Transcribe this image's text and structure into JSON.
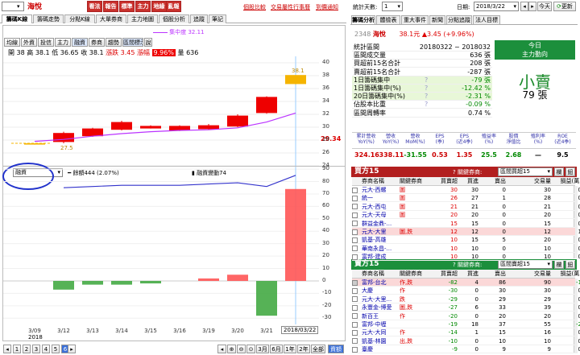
{
  "stock": {
    "code": "2348",
    "name": "海悅",
    "price": "38.1元",
    "change": "▲3.45 (+9.96%)"
  },
  "top": {
    "dropdown": "",
    "buttons": [
      "看法",
      "報告",
      "標準",
      "主力",
      "地緣",
      "亂報"
    ],
    "links": [
      "個股比較",
      "交易屬性",
      "行事曆",
      "到價通知"
    ]
  },
  "left_tabs": [
    "籌碼K線",
    "籌碼走勢",
    "分點K線",
    "大單券商",
    "主力地圖",
    "個股分析",
    "追蹤",
    "筆記"
  ],
  "toolbar": {
    "buttons": [
      "均線",
      "外資",
      "投信",
      "主力",
      "融資",
      "券商",
      "趨勢",
      "區間標示",
      "說"
    ],
    "ma_label": "集中度 32.11"
  },
  "ohlc": {
    "open_l": "開",
    "open": "38",
    "high_l": "高",
    "high": "38.1",
    "low_l": "低",
    "low": "36.65",
    "close_l": "收",
    "close": "38.1",
    "chg_l": "漲跌",
    "chg": "3.45",
    "pct_l": "漲幅",
    "pct": "9.96%",
    "vol_l": "量",
    "vol": "636"
  },
  "price_axis": [
    "40",
    "38",
    "36",
    "34",
    "32",
    "30",
    "28",
    "26",
    "24"
  ],
  "price_tag": "29.34",
  "bar_labels": {
    "top": "38.1",
    "bottom": "27.5"
  },
  "sub": {
    "select": "融資",
    "left_legend": "━ 餘額444 (2.07%)",
    "right_legend": "▮ 融資變動74"
  },
  "sub_axis": [
    "90",
    "80",
    "70",
    "60",
    "50",
    "40",
    "30",
    "20",
    "10",
    "0",
    "-10",
    "-20",
    "-30"
  ],
  "dates": [
    "3/09",
    "3/12",
    "3/13",
    "3/14",
    "3/15",
    "3/16",
    "3/19",
    "3/20",
    "3/21"
  ],
  "year": "2018",
  "date_tag": "2018/03/22",
  "pager": {
    "pages": [
      "1",
      "2",
      "3",
      "4",
      "5",
      "6"
    ],
    "ranges": [
      "3月",
      "6月",
      "1年",
      "2年",
      "全部"
    ],
    "active": "6",
    "zoom_active": "資額"
  },
  "right_top": {
    "days_label": "統計天數:",
    "days": "1",
    "date_label": "日期:",
    "date": "2018/3/22",
    "today": "今天",
    "refresh": "更新"
  },
  "right_tabs": [
    "籌碼分析",
    "體檢表",
    "重大事件",
    "新聞",
    "分點追蹤",
    "法人目標"
  ],
  "stats": [
    {
      "label": "統計區間",
      "value": "20180322 ~ 2018032"
    },
    {
      "label": "區間成交量",
      "value": "636 張"
    },
    {
      "label": "買超前15名合計",
      "value": "208 張"
    },
    {
      "label": "賣超前15名合計",
      "value": "-287 張"
    },
    {
      "label": "1日籌碼集中",
      "value": "-79 張"
    },
    {
      "label": "1日籌碼集中(%)",
      "value": "-12.42 %"
    },
    {
      "label": "20日籌碼集中(%)",
      "value": "-2.31 %"
    },
    {
      "label": "佔股本比重",
      "value": "-0.09 %"
    },
    {
      "label": "區間周轉率",
      "value": "0.74 %"
    }
  ],
  "today_box": {
    "title": "今日",
    "sub": "主力動向",
    "action": "小賣",
    "amount": "79 張"
  },
  "kpi": {
    "headers": [
      "累計營收\nYoY(%)",
      "營收\nYoY(%)",
      "營收\nMoM(%)",
      "EPS\n(季)",
      "EPS\n(近4季)",
      "殖益率\n(%)",
      "股價\n淨值比",
      "殖利率\n(%)",
      "ROE\n(近4季)"
    ],
    "values": [
      "324.16",
      "338.11",
      "-31.55",
      "0.53",
      "1.35",
      "25.5",
      "2.68",
      "—",
      "9.5"
    ]
  },
  "buy": {
    "title": "買方15",
    "ctrl": "關鍵券商:",
    "select": "區間買超15",
    "b1": "欄",
    "b2": "鈕",
    "headers": [
      "",
      "券商名稱",
      "關鍵券商",
      "買賣超",
      "買進",
      "賣出",
      "交易量",
      "損益(萬)"
    ],
    "rows": [
      [
        "元大-西螺",
        "圖",
        "30",
        "30",
        "0",
        "30",
        "0"
      ],
      [
        "統一",
        "圖",
        "26",
        "27",
        "1",
        "28",
        "0"
      ],
      [
        "元大-西屯",
        "圖",
        "21",
        "21",
        "0",
        "21",
        "0"
      ],
      [
        "元大-天母",
        "圖",
        "20",
        "20",
        "0",
        "20",
        "0"
      ],
      [
        "群益金鼎-...",
        "",
        "15",
        "15",
        "0",
        "15",
        "0"
      ],
      [
        "元大-大里",
        "圖,跌",
        "12",
        "12",
        "0",
        "12",
        "1"
      ],
      [
        "凱基-高雄",
        "",
        "10",
        "15",
        "5",
        "20",
        "0"
      ],
      [
        "華南永昌-...",
        "",
        "10",
        "10",
        "0",
        "10",
        "0"
      ],
      [
        "富邦-建成",
        "",
        "10",
        "10",
        "0",
        "10",
        "0"
      ]
    ]
  },
  "sell": {
    "title": "賣方15",
    "ctrl": "關鍵券商:",
    "select": "區間賣超15",
    "b1": "欄",
    "b2": "鈕",
    "headers": [
      "",
      "券商名稱",
      "關鍵券商",
      "買賣超",
      "買進",
      "賣出",
      "交易量",
      "損益(萬)"
    ],
    "rows": [
      [
        "富邦-台北",
        "作,跌",
        "-82",
        "4",
        "86",
        "90",
        "-1"
      ],
      [
        "大慶",
        "作",
        "-30",
        "0",
        "30",
        "30",
        "0"
      ],
      [
        "元大-大里...",
        "跌",
        "-29",
        "0",
        "29",
        "29",
        "0"
      ],
      [
        "永豐金-博愛",
        "圖,跌",
        "-27",
        "6",
        "33",
        "39",
        "0"
      ],
      [
        "新百王",
        "作",
        "-20",
        "0",
        "20",
        "20",
        "0"
      ],
      [
        "富邦-中壢",
        "",
        "-19",
        "18",
        "37",
        "55",
        "-2"
      ],
      [
        "元大-大同",
        "作",
        "-14",
        "1",
        "15",
        "16",
        "0"
      ],
      [
        "凱基-林園",
        "出,跌",
        "-10",
        "0",
        "10",
        "10",
        "0"
      ],
      [
        "臺慶",
        "",
        "-9",
        "0",
        "9",
        "9",
        "0"
      ]
    ]
  },
  "chart_data": [
    {
      "type": "candlestick",
      "title": "",
      "categories": [
        "3/09",
        "3/12",
        "3/13",
        "3/14",
        "3/15",
        "3/16",
        "3/19",
        "3/20",
        "3/21",
        "3/22"
      ],
      "open": [
        27.3,
        27.7,
        28.6,
        29.6,
        29.8,
        29.5,
        29.7,
        30.1,
        32.2,
        36.7
      ],
      "close": [
        27.5,
        29.1,
        29.8,
        30.8,
        30.2,
        30.2,
        30.3,
        31.8,
        34.7,
        38.1
      ],
      "high": [
        27.5,
        29.3,
        29.9,
        31.0,
        30.3,
        30.3,
        30.5,
        32.0,
        34.8,
        38.1
      ],
      "low": [
        27.3,
        27.5,
        28.5,
        29.5,
        29.8,
        29.4,
        29.6,
        30.0,
        32.1,
        36.65
      ],
      "ylim": [
        24,
        41
      ]
    },
    {
      "type": "bar",
      "title": "",
      "categories": [
        "3/09",
        "3/12",
        "3/13",
        "3/14",
        "3/15",
        "3/16",
        "3/19",
        "3/20",
        "3/21",
        "3/22"
      ],
      "series": [
        {
          "name": "融資變動",
          "values": [
            0,
            -7,
            -3,
            -3,
            -2,
            0,
            2,
            5,
            -28,
            74
          ]
        }
      ],
      "line": {
        "name": "餘額",
        "values": [
          0,
          75,
          76,
          77,
          77,
          77,
          78,
          79,
          76,
          85
        ]
      },
      "ylim": [
        -35,
        92
      ]
    }
  ]
}
